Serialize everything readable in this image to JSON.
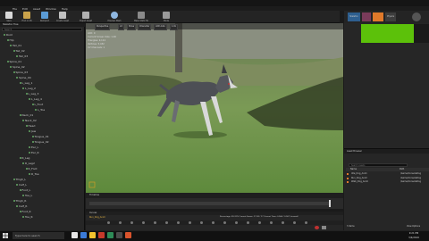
{
  "menu": {
    "items": [
      "File",
      "Edit",
      "Asset",
      "Window",
      "Help"
    ]
  },
  "toolbar": {
    "buttons": [
      {
        "label": "Save",
        "icon": "save-icon",
        "color": "#d9d9d9"
      },
      {
        "label": "Find in CB",
        "icon": "folder-icon",
        "color": "#c9a24a"
      },
      {
        "label": "Reimport",
        "icon": "reimport-icon",
        "color": "#5a9bd5"
      },
      {
        "label": "Create Asset",
        "icon": "create-asset-icon",
        "color": "#c0c0c0"
      },
      {
        "label": "Export Asset",
        "icon": "export-icon",
        "color": "#b0b0b0"
      },
      {
        "label": "Preview Mesh",
        "icon": "preview-mesh-icon",
        "color": "#8fb7e0"
      },
      {
        "label": "Make Static Mesh",
        "icon": "static-mesh-icon",
        "color": "#8a8a8a"
      },
      {
        "label": "Mode",
        "icon": "mode-icon",
        "color": "#9a9a9a"
      }
    ]
  },
  "right_toolbar": {
    "modes": [
      "Skeleton",
      "Mesh",
      "Animation",
      "Physics"
    ]
  },
  "left_panel": {
    "tab": "Skeleton Tree",
    "search_placeholder": "Search",
    "bones": [
      "Root",
      "Hip",
      "Tail_01",
      "Tail_02",
      "Tail_03",
      "Spine_01",
      "Spine_02",
      "Spine_03",
      "Spine_04",
      "L_Leg_1",
      "L_Leg_2",
      "L_Leg_3",
      "L_Leg_4",
      "L_Foot",
      "L_Toe",
      "Neck_01",
      "Neck_02",
      "Head",
      "Jaw",
      "Tongue_01",
      "Tongue_02",
      "Ear_L",
      "Ear_R",
      "R_Leg",
      "R_Leg2",
      "R_Foot",
      "R_Toe",
      "Thigh_L",
      "Calf_L",
      "Foot_L",
      "Toe_L",
      "Thigh_R",
      "Calf_R",
      "Foot_R",
      "Toe_R"
    ]
  },
  "viewport": {
    "toolbar": [
      "Perspective",
      "Lit",
      "Show",
      "Character",
      "LOD Auto",
      "1.0x"
    ],
    "stats": [
      "LOD: 0",
      "Current Screen Size: 1.00",
      "Triangles: 9,114",
      "Vertices: 5,432",
      "UV Channels: 1",
      "Approx Size: 96x98x46"
    ]
  },
  "timeline": {
    "label": "Timeline",
    "play_label": "Curves"
  },
  "anim_bar": {
    "asset": "Run_Dog_Anim",
    "info": "Percentage: 99.31%  Current Frame: 17.43 / 17  Current Time: 0.566 / 0.567 (second)"
  },
  "asset_browser": {
    "title": "Asset Browser",
    "search_placeholder": "Search Assets",
    "columns": [
      "Name",
      "Path"
    ],
    "rows": [
      {
        "name": "Idle_Dog_Anim",
        "path": "/Game/ConsoleDog"
      },
      {
        "name": "Run_Dog_Anim",
        "path": "/Game/ConsoleDog"
      },
      {
        "name": "Walk_Dog_Anim",
        "path": "/Game/ConsoleDog"
      }
    ],
    "count": "3 items",
    "view_options": "View Options"
  },
  "taskbar": {
    "search_text": "Type here to search",
    "time": "9:21 PM",
    "date": "3/4/2019",
    "app_colors": [
      "#e6e6e6",
      "#3b7bd8",
      "#f2c22e",
      "#c63a2b",
      "#2e8b57",
      "#4a4a4a",
      "#d9532c"
    ]
  },
  "colors": {
    "preview_green": "#5cc10a",
    "accent_orange": "#e0792a"
  }
}
